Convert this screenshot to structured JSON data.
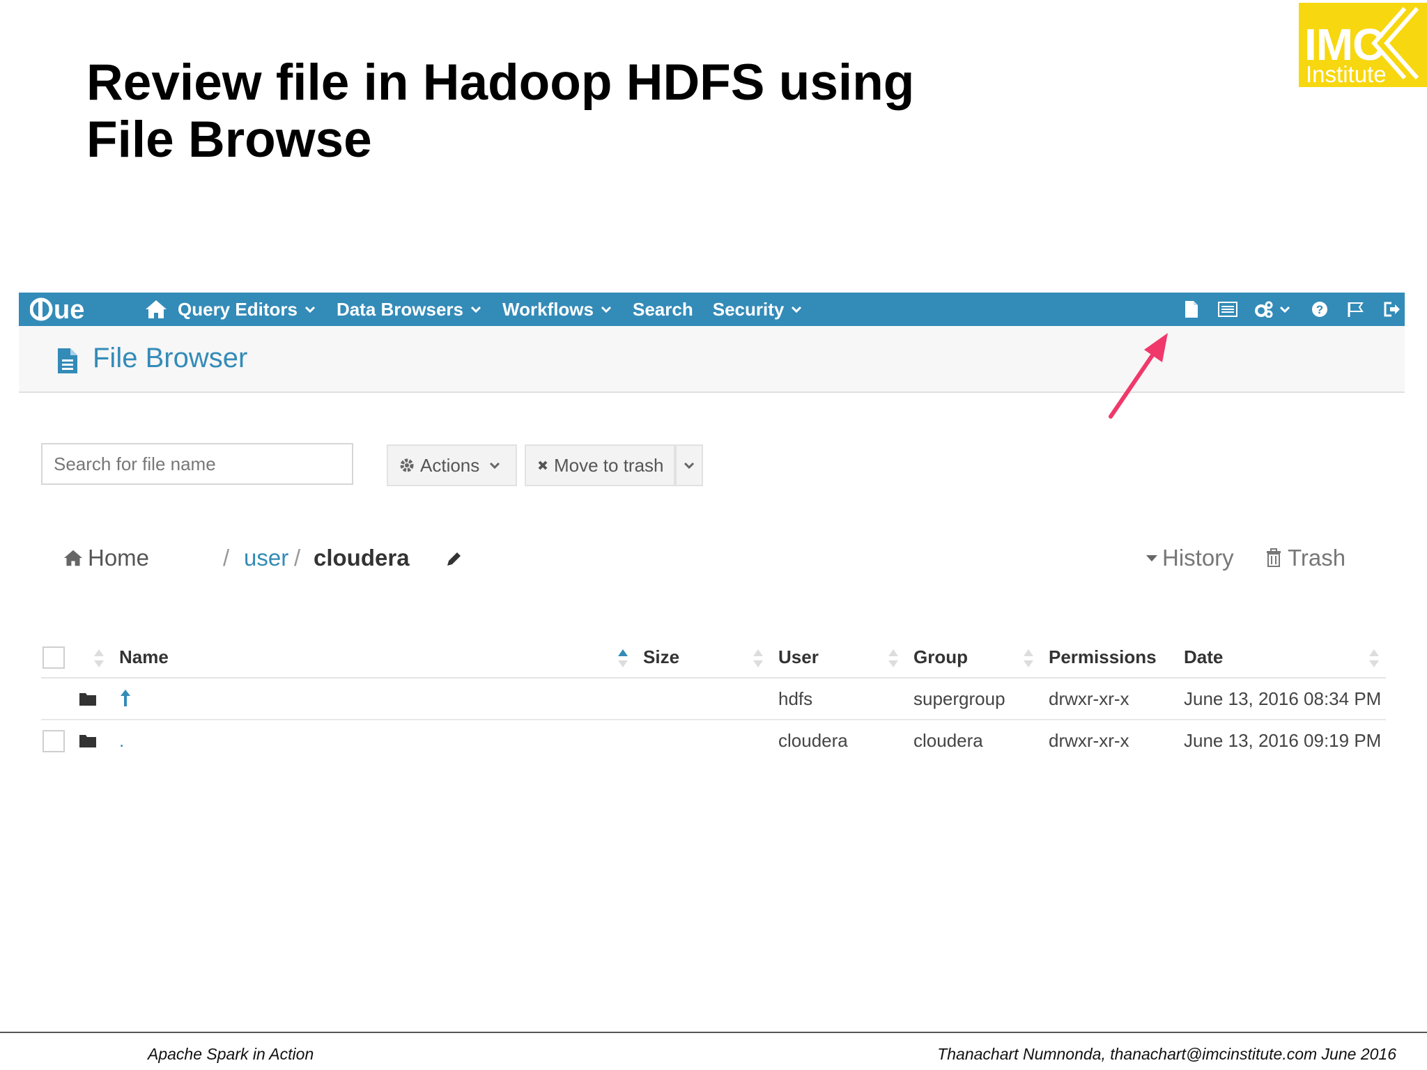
{
  "slide": {
    "title_line1": "Review file in Hadoop HDFS using",
    "title_line2": "File Browse"
  },
  "logo": {
    "main": "IMC",
    "sub": "Institute",
    "color": "#f7d70f"
  },
  "hue_bar": {
    "brand": "HUE",
    "color": "#338bb8",
    "nav": [
      {
        "label": "Query Editors",
        "dropdown": true
      },
      {
        "label": "Data Browsers",
        "dropdown": true
      },
      {
        "label": "Workflows",
        "dropdown": true
      },
      {
        "label": "Search",
        "dropdown": false
      },
      {
        "label": "Security",
        "dropdown": true
      }
    ],
    "right_icons": [
      "file-browser-icon",
      "table-browser-icon",
      "settings-cogs-icon",
      "help-icon",
      "flag-icon",
      "logout-icon"
    ]
  },
  "file_browser": {
    "title": "File Browser",
    "search_placeholder": "Search for file name",
    "actions_label": "Actions",
    "move_to_trash_label": "Move to trash",
    "breadcrumb": {
      "home": "Home",
      "segment": "user",
      "current": "cloudera",
      "sep": "/"
    },
    "history_label": "History",
    "trash_label": "Trash",
    "table": {
      "headers": {
        "name": "Name",
        "size": "Size",
        "user": "User",
        "group": "Group",
        "permissions": "Permissions",
        "date": "Date"
      },
      "rows": [
        {
          "name": "",
          "size": "",
          "user": "hdfs",
          "group": "supergroup",
          "permissions": "drwxr-xr-x",
          "date": "June 13, 2016 08:34 PM",
          "is_parent": true
        },
        {
          "name": ".",
          "size": "",
          "user": "cloudera",
          "group": "cloudera",
          "permissions": "drwxr-xr-x",
          "date": "June 13, 2016 09:19 PM",
          "is_parent": false
        }
      ]
    }
  },
  "footer": {
    "left": "Apache Spark in Action",
    "right": "Thanachart Numnonda,  thanachart@imcinstitute.com  June 2016"
  },
  "annotation_color": "#f0386b"
}
